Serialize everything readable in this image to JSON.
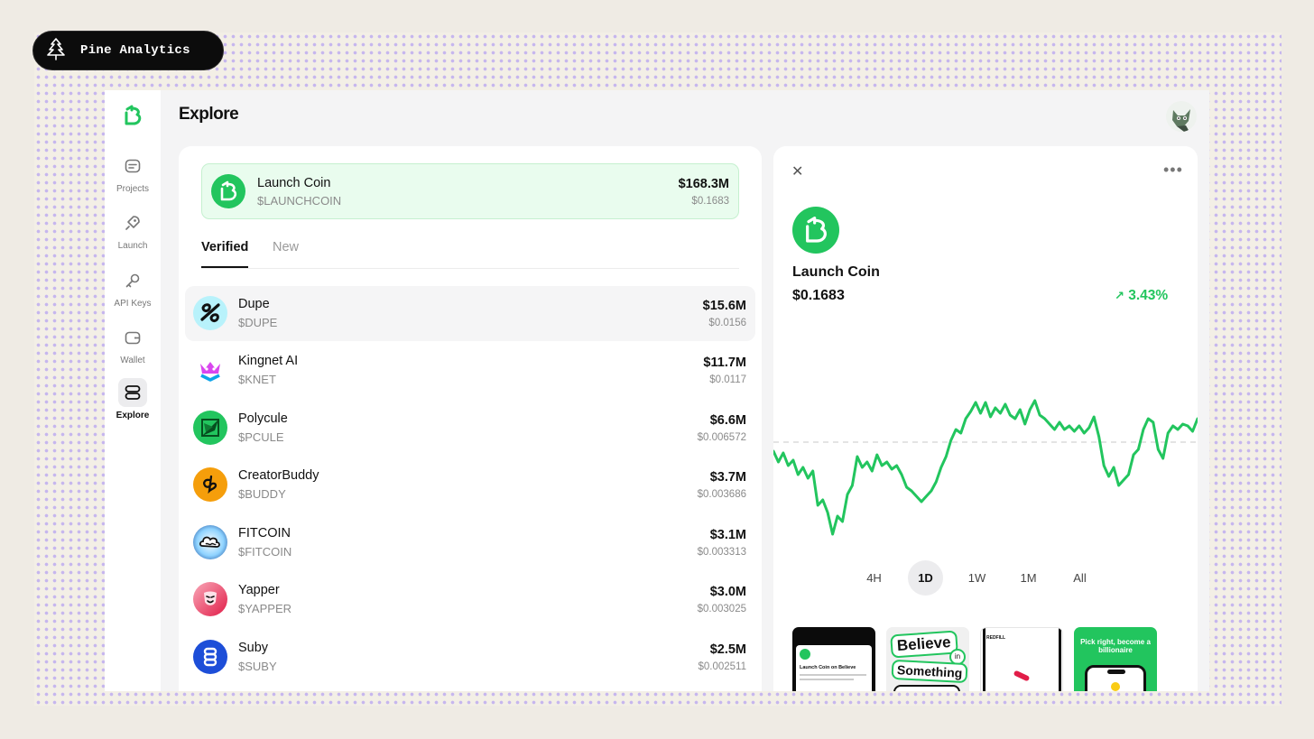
{
  "brand": {
    "name": "Pine Analytics"
  },
  "page": {
    "title": "Explore"
  },
  "sidebar": {
    "items": [
      {
        "label": "Projects",
        "icon": "projects-icon"
      },
      {
        "label": "Launch",
        "icon": "rocket-icon"
      },
      {
        "label": "API Keys",
        "icon": "key-icon"
      },
      {
        "label": "Wallet",
        "icon": "wallet-icon"
      },
      {
        "label": "Explore",
        "icon": "explore-icon",
        "active": true
      }
    ]
  },
  "featured": {
    "name": "Launch Coin",
    "ticker": "$LAUNCHCOIN",
    "market_cap": "$168.3M",
    "price": "$0.1683"
  },
  "tabs": [
    {
      "label": "Verified",
      "active": true
    },
    {
      "label": "New",
      "active": false
    }
  ],
  "coins": [
    {
      "name": "Dupe",
      "ticker": "$DUPE",
      "market_cap": "$15.6M",
      "price": "$0.0156"
    },
    {
      "name": "Kingnet AI",
      "ticker": "$KNET",
      "market_cap": "$11.7M",
      "price": "$0.0117"
    },
    {
      "name": "Polycule",
      "ticker": "$PCULE",
      "market_cap": "$6.6M",
      "price": "$0.006572"
    },
    {
      "name": "CreatorBuddy",
      "ticker": "$BUDDY",
      "market_cap": "$3.7M",
      "price": "$0.003686"
    },
    {
      "name": "FITCOIN",
      "ticker": "$FITCOIN",
      "market_cap": "$3.1M",
      "price": "$0.003313"
    },
    {
      "name": "Yapper",
      "ticker": "$YAPPER",
      "market_cap": "$3.0M",
      "price": "$0.003025"
    },
    {
      "name": "Suby",
      "ticker": "$SUBY",
      "market_cap": "$2.5M",
      "price": "$0.002511"
    }
  ],
  "detail": {
    "name": "Launch Coin",
    "price": "$0.1683",
    "change": "3.43%",
    "ranges": [
      "4H",
      "1D",
      "1W",
      "1M",
      "All"
    ],
    "active_range": "1D",
    "thumbnails": [
      {
        "caption": "Launch Coin on Believe"
      },
      {
        "line1": "Believe",
        "line2": "in",
        "line3": "Something"
      },
      {
        "caption": "REDFILL"
      },
      {
        "caption": "Pick right, become a billionaire"
      }
    ]
  },
  "colors": {
    "accent": "#22c55e",
    "featured_bg": "#e9fcee"
  },
  "chart_data": {
    "type": "line",
    "series": [
      {
        "values": [
          0.158,
          0.152,
          0.157,
          0.15,
          0.153,
          0.145,
          0.149,
          0.143,
          0.147,
          0.128,
          0.131,
          0.124,
          0.112,
          0.122,
          0.119,
          0.134,
          0.139,
          0.155,
          0.149,
          0.152,
          0.147,
          0.156,
          0.15,
          0.152,
          0.148,
          0.15,
          0.145,
          0.138,
          0.136,
          0.133,
          0.13,
          0.133,
          0.136,
          0.141,
          0.149,
          0.155,
          0.164,
          0.17,
          0.168,
          0.176,
          0.18,
          0.185,
          0.179,
          0.185,
          0.177,
          0.182,
          0.179,
          0.184,
          0.178,
          0.176,
          0.181,
          0.173,
          0.181,
          0.186,
          0.178,
          0.176,
          0.173,
          0.17,
          0.174,
          0.17,
          0.172,
          0.169,
          0.172,
          0.168,
          0.171,
          0.177,
          0.166,
          0.15,
          0.144,
          0.149,
          0.139,
          0.142,
          0.145,
          0.156,
          0.159,
          0.17,
          0.176,
          0.174,
          0.159,
          0.154,
          0.168,
          0.172,
          0.17,
          0.173,
          0.172,
          0.169,
          0.176
        ]
      }
    ],
    "reference_line": 0.163,
    "ylim": [
      0.1,
      0.2
    ],
    "grid": false,
    "legend": "none"
  }
}
